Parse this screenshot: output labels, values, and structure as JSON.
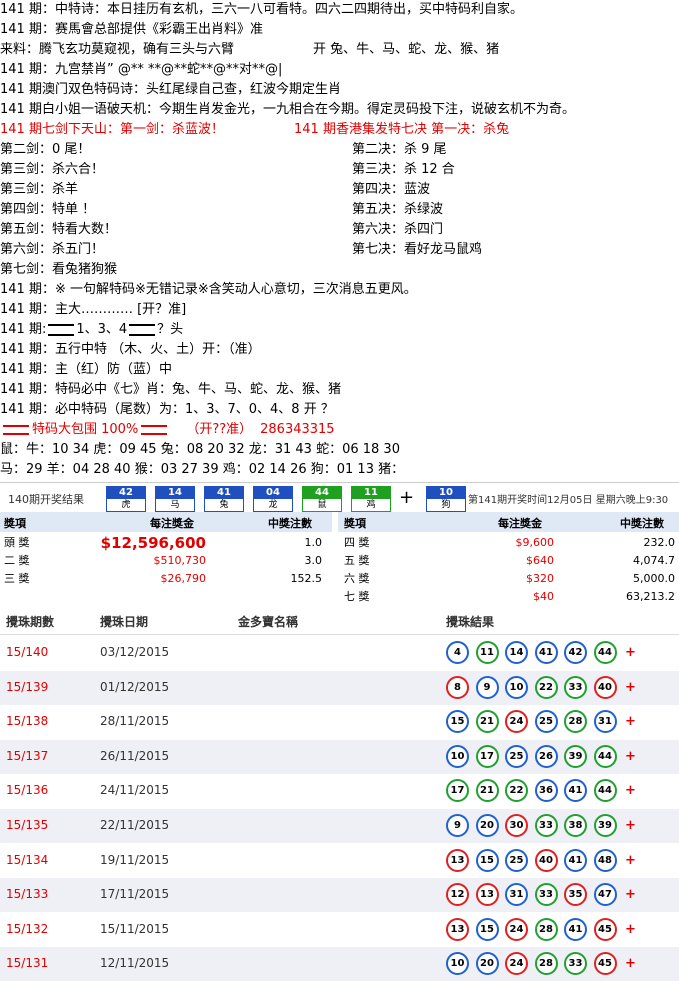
{
  "lines": {
    "l1": "141 期：中特诗：本日挂历有玄机，三六一八可看特。四六二四期待出，买中特码利自家。",
    "l2": "141 期：赛馬會总部提供《彩霸王出肖料》准",
    "l3a": "来料：腾飞玄功莫窥视，确有三头与六臂",
    "l3b": "开  兔、牛、马、蛇、龙、猴、猪",
    "l4": "141 期：九宫禁肖” @** **@**蛇**@**对**@|",
    "l5": "141 期澳门双色特码诗：头红尾绿自己查，红波今期定生肖",
    "l6": "141 期白小姐一语破天机：今期生肖发金光，一九相合在今期。得定灵码投下注，说破玄机不为奇。",
    "l7a": "141 期七剑下天山：第一剑：杀蓝波！",
    "l7b": "141 期香港集发特七决  第一决：杀兔",
    "swords": [
      {
        "left": "第二剑：0 尾！",
        "right": "第二决：杀 9 尾"
      },
      {
        "left": "第三剑：杀六合！",
        "right": "第三决：杀 12 合"
      },
      {
        "left": "第三剑：杀羊",
        "right": "第四决：蓝波"
      },
      {
        "left": "第四剑：特单  ！",
        "right": "第五决：杀绿波"
      },
      {
        "left": "第五剑：特看大数！",
        "right": "第六决：杀四门"
      },
      {
        "left": "第六剑：杀五门！",
        "right": "第七决：看好龙马鼠鸡"
      }
    ],
    "l14": "第七剑：看兔猪狗猴",
    "l15": "141 期：※ 一句解特码※无错记录※含笑动人心意切，三次消息五更风。",
    "l16": "141 期：主大………… [开？准]",
    "l17a": "141 期:",
    "l17b": "1、3、4",
    "l17c": "？头",
    "l18": "141 期：五行中特    （木、火、土）开：（准）",
    "l19": "141 期：主（红）防（蓝）中",
    "l20": "141 期：特码必中《七》肖：兔、牛、马、蛇、龙、猴、猪",
    "l21": "141 期：必中特码（尾数）为：1、3、7、0、4、8        开 ？",
    "l22a": "特码大包围 100%",
    "l22b": "（开??准）",
    "l22c": "286343315",
    "l23": "鼠：牛：10 34 虎：09 45 兔：08 20 32 龙：31 43 蛇：06 18 30",
    "l24": "马：29   羊：04 28 40 猴：03 27 39 鸡：02 14 26 狗：01 13 猪："
  },
  "draw": {
    "label": "140期开奖结果",
    "balls": [
      {
        "num": "42",
        "zodiac": "虎",
        "color": "blue"
      },
      {
        "num": "14",
        "zodiac": "马",
        "color": "blue"
      },
      {
        "num": "41",
        "zodiac": "兔",
        "color": "blue"
      },
      {
        "num": "04",
        "zodiac": "龙",
        "color": "blue"
      },
      {
        "num": "44",
        "zodiac": "鼠",
        "color": "green"
      },
      {
        "num": "11",
        "zodiac": "鸡",
        "color": "green"
      }
    ],
    "special": {
      "num": "10",
      "zodiac": "狗",
      "color": "blue"
    },
    "plus": "+",
    "info": "第141期开奖时间12月05日 星期六晚上9:30"
  },
  "prizes": {
    "headers": {
      "item": "獎項",
      "amount": "每注獎金",
      "count": "中獎注數"
    },
    "left": [
      {
        "name": "頭 獎",
        "amount": "$12,596,600",
        "count": "1.0"
      },
      {
        "name": "二 獎",
        "amount": "$510,730",
        "count": "3.0"
      },
      {
        "name": "三 獎",
        "amount": "$26,790",
        "count": "152.5"
      }
    ],
    "right": [
      {
        "name": "四 獎",
        "amount": "$9,600",
        "count": "232.0"
      },
      {
        "name": "五 獎",
        "amount": "$640",
        "count": "4,074.7"
      },
      {
        "name": "六 獎",
        "amount": "$320",
        "count": "5,000.0"
      },
      {
        "name": "七 獎",
        "amount": "$40",
        "count": "63,213.2"
      }
    ]
  },
  "history": {
    "headers": {
      "issue": "攪珠期數",
      "date": "攪珠日期",
      "bonus": "金多寶名稱",
      "result": "攪珠結果"
    },
    "plus": "+",
    "rows": [
      {
        "issue": "15/140",
        "date": "03/12/2015",
        "balls": [
          [
            "4",
            "blue"
          ],
          [
            "11",
            "green"
          ],
          [
            "14",
            "blue"
          ],
          [
            "41",
            "blue"
          ],
          [
            "42",
            "blue"
          ],
          [
            "44",
            "green"
          ]
        ]
      },
      {
        "issue": "15/139",
        "date": "01/12/2015",
        "balls": [
          [
            "8",
            "red"
          ],
          [
            "9",
            "blue"
          ],
          [
            "10",
            "blue"
          ],
          [
            "22",
            "green"
          ],
          [
            "33",
            "green"
          ],
          [
            "40",
            "red"
          ]
        ]
      },
      {
        "issue": "15/138",
        "date": "28/11/2015",
        "balls": [
          [
            "15",
            "blue"
          ],
          [
            "21",
            "green"
          ],
          [
            "24",
            "red"
          ],
          [
            "25",
            "blue"
          ],
          [
            "28",
            "green"
          ],
          [
            "31",
            "blue"
          ]
        ]
      },
      {
        "issue": "15/137",
        "date": "26/11/2015",
        "balls": [
          [
            "10",
            "blue"
          ],
          [
            "17",
            "green"
          ],
          [
            "25",
            "blue"
          ],
          [
            "26",
            "blue"
          ],
          [
            "39",
            "green"
          ],
          [
            "44",
            "green"
          ]
        ]
      },
      {
        "issue": "15/136",
        "date": "24/11/2015",
        "balls": [
          [
            "17",
            "green"
          ],
          [
            "21",
            "green"
          ],
          [
            "22",
            "green"
          ],
          [
            "36",
            "blue"
          ],
          [
            "41",
            "blue"
          ],
          [
            "44",
            "green"
          ]
        ]
      },
      {
        "issue": "15/135",
        "date": "22/11/2015",
        "balls": [
          [
            "9",
            "blue"
          ],
          [
            "20",
            "blue"
          ],
          [
            "30",
            "red"
          ],
          [
            "33",
            "green"
          ],
          [
            "38",
            "green"
          ],
          [
            "39",
            "green"
          ]
        ]
      },
      {
        "issue": "15/134",
        "date": "19/11/2015",
        "balls": [
          [
            "13",
            "red"
          ],
          [
            "15",
            "blue"
          ],
          [
            "25",
            "blue"
          ],
          [
            "40",
            "red"
          ],
          [
            "41",
            "blue"
          ],
          [
            "48",
            "blue"
          ]
        ]
      },
      {
        "issue": "15/133",
        "date": "17/11/2015",
        "balls": [
          [
            "12",
            "red"
          ],
          [
            "13",
            "red"
          ],
          [
            "31",
            "blue"
          ],
          [
            "33",
            "green"
          ],
          [
            "35",
            "red"
          ],
          [
            "47",
            "blue"
          ]
        ]
      },
      {
        "issue": "15/132",
        "date": "15/11/2015",
        "balls": [
          [
            "13",
            "red"
          ],
          [
            "15",
            "blue"
          ],
          [
            "24",
            "red"
          ],
          [
            "28",
            "green"
          ],
          [
            "41",
            "blue"
          ],
          [
            "45",
            "red"
          ]
        ]
      },
      {
        "issue": "15/131",
        "date": "12/11/2015",
        "balls": [
          [
            "10",
            "blue"
          ],
          [
            "20",
            "blue"
          ],
          [
            "24",
            "red"
          ],
          [
            "28",
            "green"
          ],
          [
            "33",
            "green"
          ],
          [
            "45",
            "red"
          ]
        ]
      }
    ]
  }
}
